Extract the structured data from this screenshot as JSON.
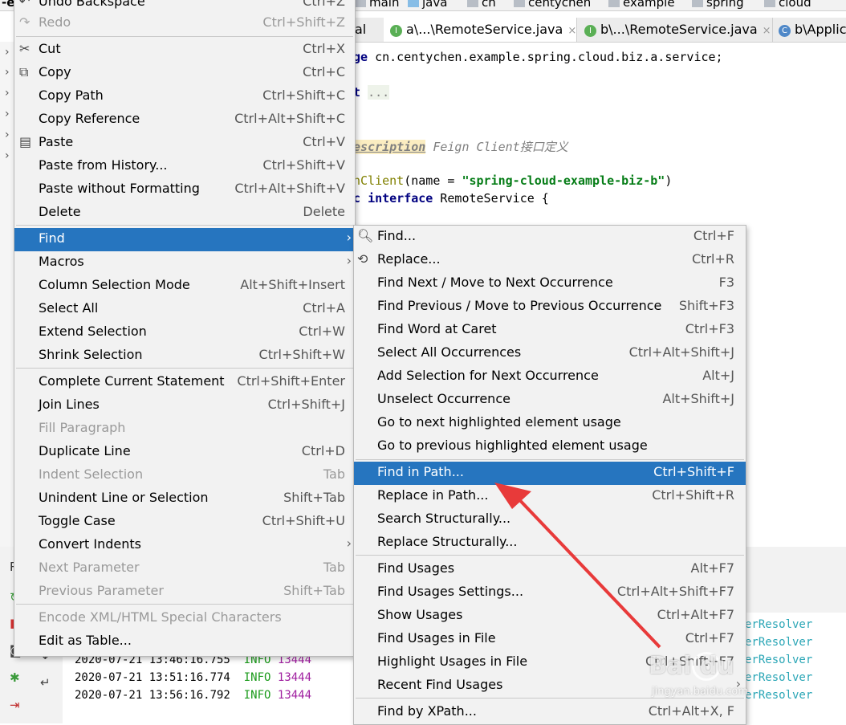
{
  "navbar": {
    "title_fragment": "-ex",
    "crumbs": [
      "main",
      "java",
      "cn",
      "centychen",
      "example",
      "spring",
      "cloud"
    ]
  },
  "tabs": [
    {
      "label": "al",
      "active": false,
      "icon": ""
    },
    {
      "label": "a\\...\\RemoteService.java",
      "active": true,
      "icon": "I",
      "close": "×"
    },
    {
      "label": "b\\...\\RemoteService.java",
      "active": false,
      "icon": "I",
      "close": "×"
    },
    {
      "label": "b\\Applic",
      "active": false,
      "icon": "C"
    }
  ],
  "editor": {
    "line1": [
      "ge ",
      "cn.centychen.example.spring.cloud.biz.a.service;"
    ],
    "line2": [
      "t ",
      "..."
    ],
    "line3": [
      "escription",
      " Feign Client接口定义"
    ],
    "line4": [
      "nClient",
      "(name = ",
      "\"spring-cloud-example-biz-b\"",
      ")"
    ],
    "line5": [
      "c ",
      "interface",
      " RemoteService {"
    ]
  },
  "run_log": [
    {
      "time": "2020-07-21 13:46:16.755",
      "level": "INFO",
      "pid": "13444"
    },
    {
      "time": "2020-07-21 13:51:16.774",
      "level": "INFO",
      "pid": "13444"
    },
    {
      "time": "2020-07-21 13:56:16.792",
      "level": "INFO",
      "pid": "13444"
    }
  ],
  "run_log_tail": [
    "erResolver",
    "erResolver",
    "erResolver",
    "erResolver",
    "erResolver"
  ],
  "edit_menu": {
    "items": [
      {
        "label": "Undo Backspace",
        "shortcut": "Ctrl+Z",
        "disabled": false
      },
      {
        "label": "Redo",
        "shortcut": "Ctrl+Shift+Z",
        "disabled": true
      },
      {
        "label": "Cut",
        "shortcut": "Ctrl+X"
      },
      {
        "label": "Copy",
        "shortcut": "Ctrl+C"
      },
      {
        "label": "Copy Path",
        "shortcut": "Ctrl+Shift+C"
      },
      {
        "label": "Copy Reference",
        "shortcut": "Ctrl+Alt+Shift+C"
      },
      {
        "label": "Paste",
        "shortcut": "Ctrl+V"
      },
      {
        "label": "Paste from History...",
        "shortcut": "Ctrl+Shift+V"
      },
      {
        "label": "Paste without Formatting",
        "shortcut": "Ctrl+Alt+Shift+V"
      },
      {
        "label": "Delete",
        "shortcut": "Delete"
      },
      {
        "label": "Find",
        "shortcut": "",
        "submenu": true,
        "selected": true
      },
      {
        "label": "Macros",
        "shortcut": "",
        "submenu": true
      },
      {
        "label": "Column Selection Mode",
        "shortcut": "Alt+Shift+Insert"
      },
      {
        "label": "Select All",
        "shortcut": "Ctrl+A"
      },
      {
        "label": "Extend Selection",
        "shortcut": "Ctrl+W"
      },
      {
        "label": "Shrink Selection",
        "shortcut": "Ctrl+Shift+W"
      },
      {
        "label": "Complete Current Statement",
        "shortcut": "Ctrl+Shift+Enter"
      },
      {
        "label": "Join Lines",
        "shortcut": "Ctrl+Shift+J"
      },
      {
        "label": "Fill Paragraph",
        "shortcut": "",
        "disabled": true
      },
      {
        "label": "Duplicate Line",
        "shortcut": "Ctrl+D"
      },
      {
        "label": "Indent Selection",
        "shortcut": "Tab",
        "disabled": true
      },
      {
        "label": "Unindent Line or Selection",
        "shortcut": "Shift+Tab"
      },
      {
        "label": "Toggle Case",
        "shortcut": "Ctrl+Shift+U"
      },
      {
        "label": "Convert Indents",
        "shortcut": "",
        "submenu": true
      },
      {
        "label": "Next Parameter",
        "shortcut": "Tab",
        "disabled": true
      },
      {
        "label": "Previous Parameter",
        "shortcut": "Shift+Tab",
        "disabled": true
      },
      {
        "label": "Encode XML/HTML Special Characters",
        "shortcut": "",
        "disabled": true
      },
      {
        "label": "Edit as Table...",
        "shortcut": ""
      }
    ]
  },
  "find_menu": {
    "items": [
      {
        "label": "Find...",
        "shortcut": "Ctrl+F"
      },
      {
        "label": "Replace...",
        "shortcut": "Ctrl+R"
      },
      {
        "label": "Find Next / Move to Next Occurrence",
        "shortcut": "F3"
      },
      {
        "label": "Find Previous / Move to Previous Occurrence",
        "shortcut": "Shift+F3"
      },
      {
        "label": "Find Word at Caret",
        "shortcut": "Ctrl+F3"
      },
      {
        "label": "Select All Occurrences",
        "shortcut": "Ctrl+Alt+Shift+J"
      },
      {
        "label": "Add Selection for Next Occurrence",
        "shortcut": "Alt+J"
      },
      {
        "label": "Unselect Occurrence",
        "shortcut": "Alt+Shift+J"
      },
      {
        "label": "Go to next highlighted element usage",
        "shortcut": ""
      },
      {
        "label": "Go to previous highlighted element usage",
        "shortcut": ""
      },
      {
        "label": "Find in Path...",
        "shortcut": "Ctrl+Shift+F",
        "selected": true
      },
      {
        "label": "Replace in Path...",
        "shortcut": "Ctrl+Shift+R"
      },
      {
        "label": "Search Structurally...",
        "shortcut": ""
      },
      {
        "label": "Replace Structurally...",
        "shortcut": ""
      },
      {
        "label": "Find Usages",
        "shortcut": "Alt+F7"
      },
      {
        "label": "Find Usages Settings...",
        "shortcut": "Ctrl+Alt+Shift+F7"
      },
      {
        "label": "Show Usages",
        "shortcut": "Ctrl+Alt+F7"
      },
      {
        "label": "Find Usages in File",
        "shortcut": "Ctrl+F7"
      },
      {
        "label": "Highlight Usages in File",
        "shortcut": "Ctrl+Shift+F7"
      },
      {
        "label": "Recent Find Usages",
        "shortcut": "",
        "submenu": true
      },
      {
        "label": "Find by XPath...",
        "shortcut": "Ctrl+Alt+X, F"
      }
    ]
  },
  "watermark": {
    "brand": "Bai du",
    "site": "jingyan.baidu.com"
  },
  "icons": {
    "cut": "scissors-icon",
    "copy": "copy-icon",
    "paste": "clipboard-icon",
    "redo": "redo-icon",
    "find": "search-icon",
    "replace": "replace-icon",
    "submenu": "chevron-right-icon"
  },
  "colors": {
    "selection": "#2675bf",
    "menu_bg": "#f2f2f2",
    "arrow": "#e83a3a"
  }
}
